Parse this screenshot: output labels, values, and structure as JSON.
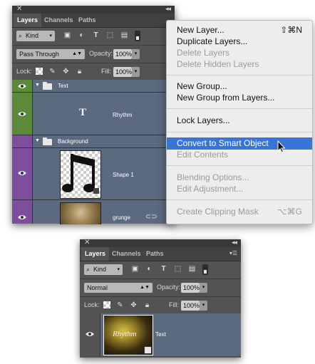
{
  "panel_top": {
    "close_glyph": "✕",
    "collapse_glyph": "◂◂",
    "tabs": [
      "Layers",
      "Channels",
      "Paths"
    ],
    "filter": {
      "label": "Kind"
    },
    "blend_mode": "Pass Through",
    "opacity_label": "Opacity:",
    "opacity_value": "100%",
    "lock_label": "Lock:",
    "fill_label": "Fill:",
    "fill_value": "100%",
    "layers": [
      {
        "name": "Text",
        "type": "group",
        "color": "#5c8a3a"
      },
      {
        "name": "Rhythm",
        "type": "text",
        "color": "#5c8a3a"
      },
      {
        "name": "Background",
        "type": "group",
        "color": "#7c4e9c"
      },
      {
        "name": "Shape 1",
        "type": "shape",
        "color": "#7c4e9c"
      },
      {
        "name": "grunge",
        "type": "image",
        "color": "#7c4e9c"
      }
    ]
  },
  "context_menu": {
    "items": [
      {
        "label": "New Layer...",
        "shortcut": "⇧⌘N",
        "disabled": false
      },
      {
        "label": "Duplicate Layers...",
        "disabled": false
      },
      {
        "label": "Delete Layers",
        "disabled": true
      },
      {
        "label": "Delete Hidden Layers",
        "disabled": true
      },
      {
        "label": "New Group...",
        "disabled": false
      },
      {
        "label": "New Group from Layers...",
        "disabled": false
      },
      {
        "label": "Lock Layers...",
        "disabled": false
      },
      {
        "label": "Convert to Smart Object",
        "disabled": false,
        "highlighted": true
      },
      {
        "label": "Edit Contents",
        "disabled": true
      },
      {
        "label": "Blending Options...",
        "disabled": true
      },
      {
        "label": "Edit Adjustment...",
        "disabled": true
      },
      {
        "label": "Create Clipping Mask",
        "shortcut": "⌥⌘G",
        "disabled": true
      }
    ]
  },
  "panel_bottom": {
    "close_glyph": "✕",
    "collapse_glyph": "◂◂",
    "tabs": [
      "Layers",
      "Channels",
      "Paths"
    ],
    "filter": {
      "label": "Kind"
    },
    "blend_mode": "Normal",
    "opacity_label": "Opacity:",
    "opacity_value": "100%",
    "lock_label": "Lock:",
    "fill_label": "Fill:",
    "fill_value": "100%",
    "layers": [
      {
        "name": "Text",
        "type": "smart-object",
        "color": "#5a6a7e"
      }
    ]
  },
  "icons": {
    "eye": "eye-icon",
    "text_tool": "T",
    "lock": "lock-icon",
    "link": "link-icon"
  },
  "colors": {
    "panel_bg": "#535353",
    "selected_layer": "#5a6a7e",
    "menu_highlight": "#3875d7",
    "green_label": "#5c8a3a",
    "purple_label": "#7c4e9c"
  }
}
